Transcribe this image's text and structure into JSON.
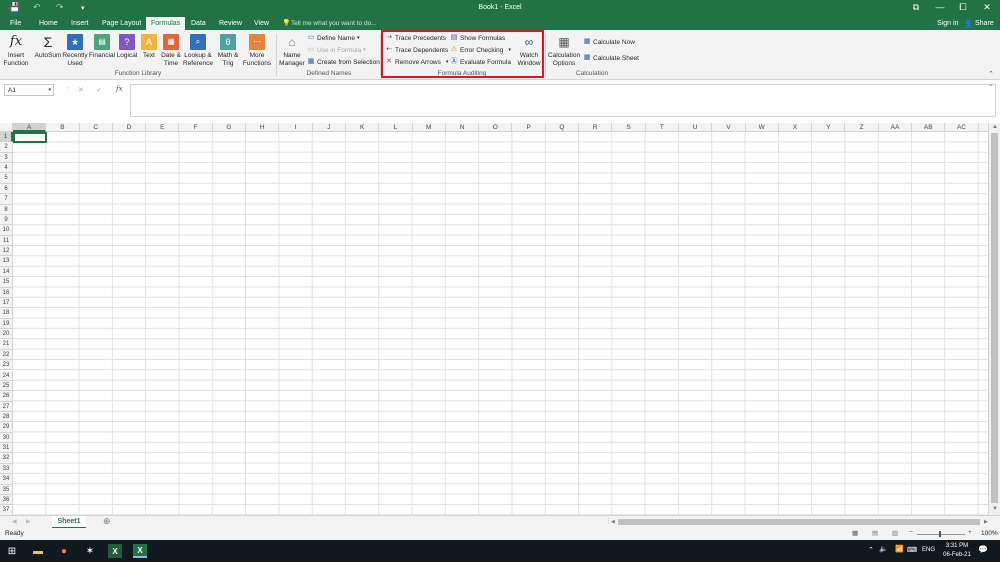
{
  "titlebar": {
    "title": "Book1 - Excel",
    "save": "💾",
    "undo": "↶",
    "redo": "↷",
    "customize": "▾",
    "ribbon_opts": "⧉",
    "minimize": "—",
    "restore": "⧠",
    "close": "✕"
  },
  "tabs": {
    "items": [
      "File",
      "Home",
      "Insert",
      "Page Layout",
      "Formulas",
      "Data",
      "Review",
      "View"
    ],
    "active": "Formulas",
    "tell_me": "Tell me what you want to do...",
    "signin": "Sign in",
    "share": "Share"
  },
  "ribbon": {
    "function_library": {
      "label": "Function Library",
      "insert_function": "Insert\nFunction",
      "autosum": "AutoSum",
      "recently_used": "Recently\nUsed",
      "financial": "Financial",
      "logical": "Logical",
      "text": "Text",
      "date_time": "Date &\nTime",
      "lookup_reference": "Lookup &\nReference",
      "math_trig": "Math &\nTrig",
      "more_functions": "More\nFunctions"
    },
    "defined_names": {
      "label": "Defined Names",
      "name_manager": "Name\nManager",
      "define_name": "Define Name",
      "use_in_formula": "Use in Formula",
      "create_from_selection": "Create from Selection"
    },
    "formula_auditing": {
      "label": "Formula Auditing",
      "trace_precedents": "Trace Precedents",
      "trace_dependents": "Trace Dependents",
      "remove_arrows": "Remove Arrows",
      "show_formulas": "Show Formulas",
      "error_checking": "Error Checking",
      "evaluate_formula": "Evaluate Formula",
      "watch_window": "Watch\nWindow"
    },
    "calculation": {
      "label": "Calculation",
      "calculation_options": "Calculation\nOptions",
      "calculate_now": "Calculate Now",
      "calculate_sheet": "Calculate Sheet"
    }
  },
  "formula_bar": {
    "name_box": "A1",
    "cancel": "✕",
    "enter": "✓",
    "fx": "fx",
    "value": ""
  },
  "grid": {
    "columns": [
      "A",
      "B",
      "C",
      "D",
      "E",
      "F",
      "G",
      "H",
      "I",
      "J",
      "K",
      "L",
      "M",
      "N",
      "O",
      "P",
      "Q",
      "R",
      "S",
      "T",
      "U",
      "V",
      "W",
      "X",
      "Y",
      "Z",
      "AA",
      "AB",
      "AC"
    ],
    "rows": [
      "1",
      "2",
      "3",
      "4",
      "5",
      "6",
      "7",
      "8",
      "9",
      "10",
      "11",
      "12",
      "13",
      "14",
      "15",
      "16",
      "17",
      "18",
      "19",
      "20",
      "21",
      "22",
      "23",
      "24",
      "25",
      "26",
      "27",
      "28",
      "29",
      "30",
      "31",
      "32",
      "33",
      "34",
      "35",
      "36",
      "37"
    ],
    "selected": "A1"
  },
  "sheets": {
    "tabs": [
      "Sheet1"
    ],
    "active": "Sheet1"
  },
  "status": {
    "text": "Ready",
    "zoom": "100%"
  },
  "taskbar": {
    "time": "3:31 PM",
    "date": "06-Feb-21",
    "lang": "ENG"
  },
  "colors": {
    "excel_green": "#217346",
    "highlight_red": "#e81123"
  }
}
